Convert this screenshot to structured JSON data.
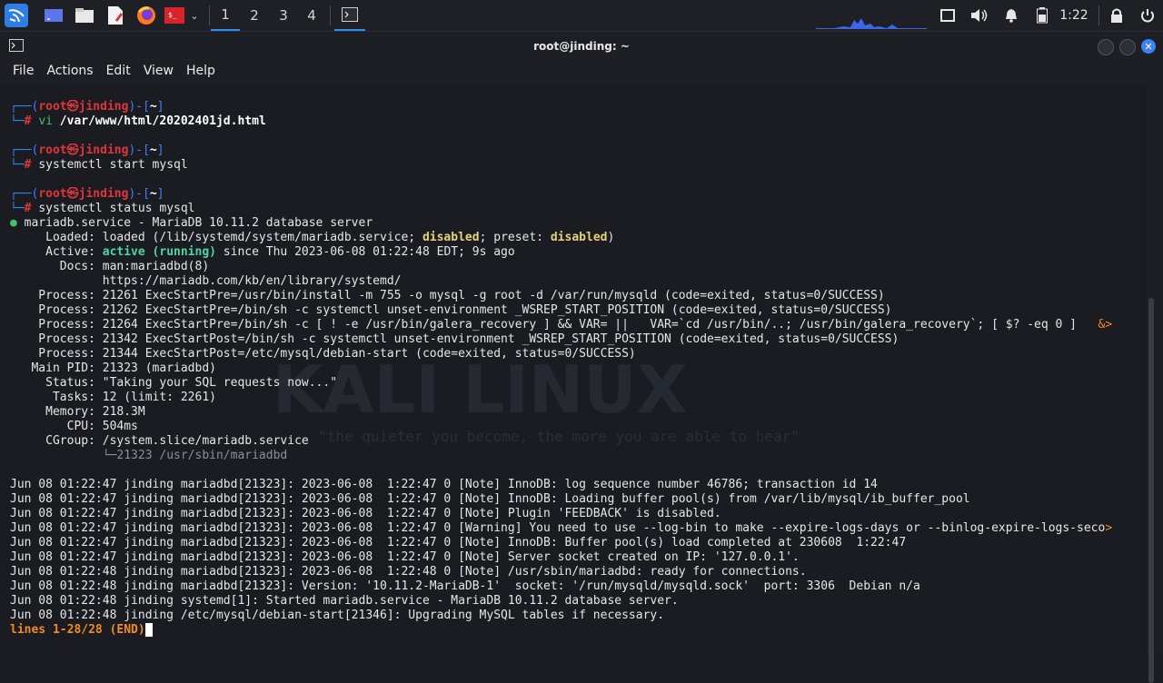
{
  "taskbar": {
    "workspaces": [
      "1",
      "2",
      "3",
      "4"
    ],
    "clock": "1:22"
  },
  "window": {
    "title": "root@jinding: ~",
    "menu": [
      "File",
      "Actions",
      "Edit",
      "View",
      "Help"
    ]
  },
  "wallpaper": {
    "brand": "KALI LINUX",
    "quote": "\"the quieter you become, the more you are able to hear\""
  },
  "terminal": {
    "user": "root",
    "host": "jinding",
    "cwd": "~",
    "commands": [
      "vi /var/www/html/20202401jd.html",
      "systemctl start mysql",
      "systemctl status mysql"
    ],
    "status": {
      "service": "mariadb.service - MariaDB 10.11.2 database server",
      "loaded_pre": "loaded (/lib/systemd/system/mariadb.service; ",
      "loaded_state": "disabled",
      "loaded_mid": "; preset: ",
      "loaded_preset": "disabled",
      "loaded_post": ")",
      "active_state": "active (running)",
      "active_since": " since Thu 2023-06-08 01:22:48 EDT; 9s ago",
      "docs1": "man:mariadbd(8)",
      "docs2": "https://mariadb.com/kb/en/library/systemd/",
      "processes": [
        "21261 ExecStartPre=/usr/bin/install -m 755 -o mysql -g root -d /var/run/mysqld (code=exited, status=0/SUCCESS)",
        "21262 ExecStartPre=/bin/sh -c systemctl unset-environment _WSREP_START_POSITION (code=exited, status=0/SUCCESS)",
        "21264 ExecStartPre=/bin/sh -c [ ! -e /usr/bin/galera_recovery ] && VAR= ||   VAR=`cd /usr/bin/..; /usr/bin/galera_recovery`; [ $? -eq 0 ]   ",
        "21342 ExecStartPost=/bin/sh -c systemctl unset-environment _WSREP_START_POSITION (code=exited, status=0/SUCCESS)",
        "21344 ExecStartPost=/etc/mysql/debian-start (code=exited, status=0/SUCCESS)"
      ],
      "main_pid": "21323 (mariadbd)",
      "status_text": "\"Taking your SQL requests now...\"",
      "tasks": "12 (limit: 2261)",
      "memory": "218.3M",
      "cpu": "504ms",
      "cgroup": "/system.slice/mariadb.service",
      "cgroup_child": "└─21323 /usr/sbin/mariadbd"
    },
    "log": [
      "Jun 08 01:22:47 jinding mariadbd[21323]: 2023-06-08  1:22:47 0 [Note] InnoDB: log sequence number 46786; transaction id 14",
      "Jun 08 01:22:47 jinding mariadbd[21323]: 2023-06-08  1:22:47 0 [Note] InnoDB: Loading buffer pool(s) from /var/lib/mysql/ib_buffer_pool",
      "Jun 08 01:22:47 jinding mariadbd[21323]: 2023-06-08  1:22:47 0 [Note] Plugin 'FEEDBACK' is disabled.",
      "Jun 08 01:22:47 jinding mariadbd[21323]: 2023-06-08  1:22:47 0 [Warning] You need to use --log-bin to make --expire-logs-days or --binlog-expire-logs-seco",
      "Jun 08 01:22:47 jinding mariadbd[21323]: 2023-06-08  1:22:47 0 [Note] InnoDB: Buffer pool(s) load completed at 230608  1:22:47",
      "Jun 08 01:22:47 jinding mariadbd[21323]: 2023-06-08  1:22:47 0 [Note] Server socket created on IP: '127.0.0.1'.",
      "Jun 08 01:22:48 jinding mariadbd[21323]: 2023-06-08  1:22:48 0 [Note] /usr/sbin/mariadbd: ready for connections.",
      "Jun 08 01:22:48 jinding mariadbd[21323]: Version: '10.11.2-MariaDB-1'  socket: '/run/mysqld/mysqld.sock'  port: 3306  Debian n/a",
      "Jun 08 01:22:48 jinding systemd[1]: Started mariadb.service - MariaDB 10.11.2 database server.",
      "Jun 08 01:22:48 jinding /etc/mysql/debian-start[21346]: Upgrading MySQL tables if necessary."
    ],
    "pager": "lines 1-28/28 (END)"
  }
}
